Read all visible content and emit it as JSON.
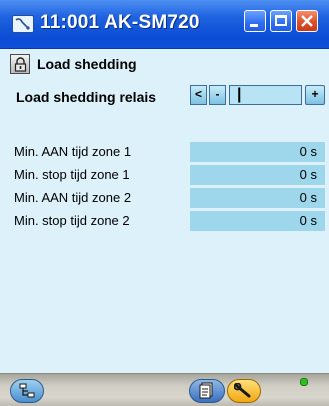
{
  "window": {
    "title": "11:001 AK-SM720",
    "minimize_label": "",
    "maximize_label": "",
    "close_label": ""
  },
  "header": {
    "title": "Load shedding"
  },
  "selector": {
    "label": "Load shedding relais",
    "first_glyph": "<",
    "prev_glyph": "-",
    "value": "|",
    "next_glyph": "+"
  },
  "parameters": [
    {
      "label": "Min. AAN tijd zone 1",
      "value": "0 s"
    },
    {
      "label": "Min. stop tijd zone 1",
      "value": "0 s"
    },
    {
      "label": "Min. AAN tijd zone 2",
      "value": "0 s"
    },
    {
      "label": "Min. stop tijd zone 2",
      "value": "0 s"
    }
  ],
  "bottombar": {
    "network_icon": "network-icon",
    "document_icon": "document-icon",
    "tool_icon": "wrench-icon",
    "status": "online"
  },
  "colors": {
    "titlebar": "#1f63e0",
    "background": "#dcf1fa",
    "value_cell": "#9ed6ec",
    "close_button": "#e0502a",
    "status_dot": "#2fbf22"
  }
}
